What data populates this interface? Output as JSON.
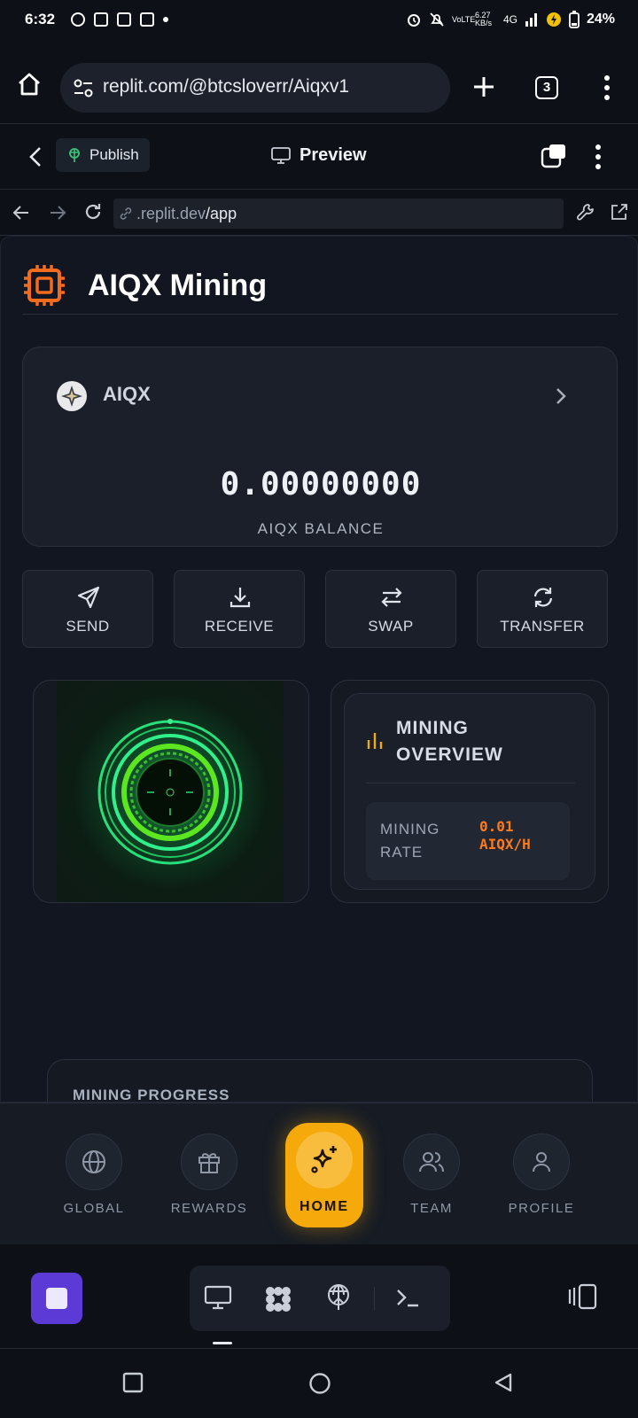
{
  "status_bar": {
    "time": "6:32",
    "network_speed": "6.27 KB/s",
    "network_type": "4G",
    "volte": "VoLTE",
    "battery": "24%"
  },
  "browser": {
    "url": "replit.com/@btcsloverr/Aiqxv1",
    "tab_count": "3"
  },
  "replit_header": {
    "publish_label": "Publish",
    "preview_label": "Preview"
  },
  "navrow": {
    "address_prefix": ".replit.dev",
    "address_path": "/app"
  },
  "app": {
    "title": "AIQX Mining",
    "balance_card": {
      "coin_name": "AIQX",
      "balance": "0.00000000",
      "balance_label": "AIQX BALANCE"
    },
    "actions": [
      {
        "label": "SEND",
        "icon": "send-icon"
      },
      {
        "label": "RECEIVE",
        "icon": "download-icon"
      },
      {
        "label": "SWAP",
        "icon": "swap-icon"
      },
      {
        "label": "TRANSFER",
        "icon": "refresh-icon"
      }
    ],
    "overview": {
      "title": "MINING OVERVIEW",
      "rate_label": "MINING RATE",
      "rate_value": "0.01 AIQX/H"
    },
    "progress": {
      "title": "MINING PROGRESS"
    },
    "colors": {
      "accent_orange": "#f5a90b",
      "mining_rate": "#ff7a1a",
      "mining_glow": "#1fe36a"
    }
  },
  "bottom_nav": [
    {
      "label": "GLOBAL",
      "icon": "globe-icon",
      "active": false
    },
    {
      "label": "REWARDS",
      "icon": "gift-icon",
      "active": false
    },
    {
      "label": "HOME",
      "icon": "sparkles-icon",
      "active": true
    },
    {
      "label": "TEAM",
      "icon": "users-icon",
      "active": false
    },
    {
      "label": "PROFILE",
      "icon": "user-icon",
      "active": false
    }
  ]
}
